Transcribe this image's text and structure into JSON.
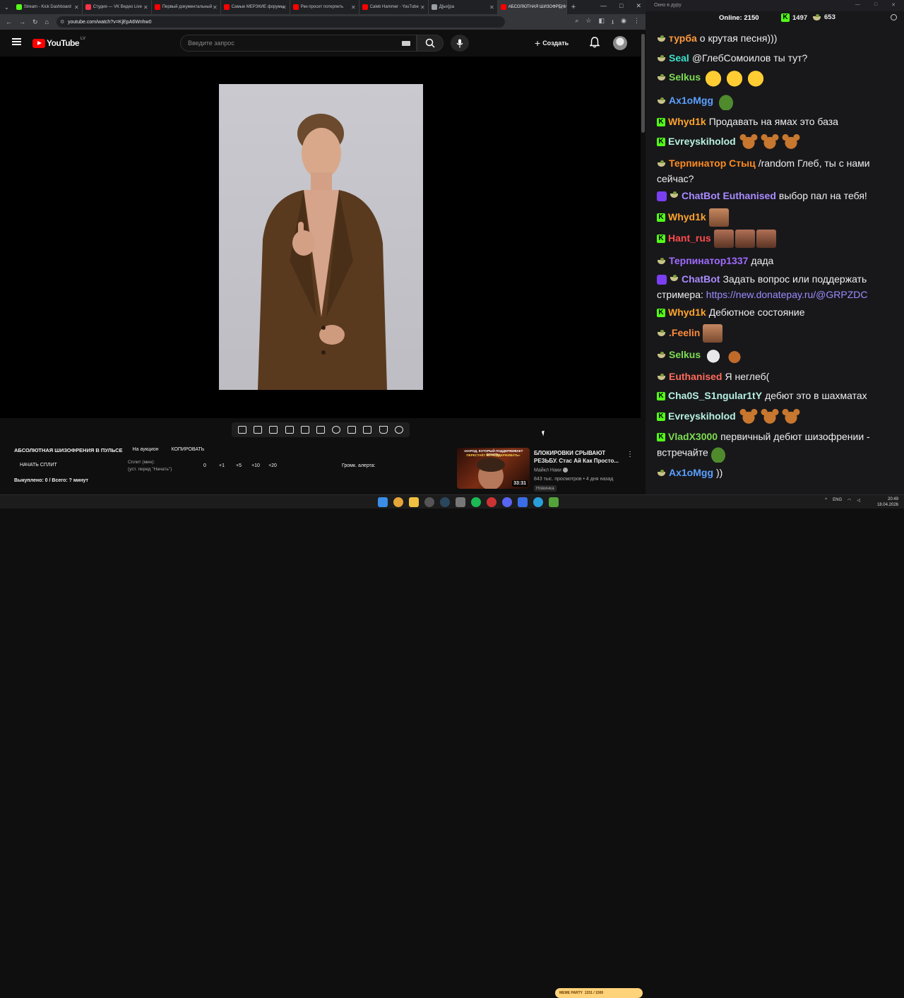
{
  "tabs": [
    {
      "label": "Stream - Kick Dashboard",
      "color": "#53fc18"
    },
    {
      "label": "Студия — VK Видео Live",
      "color": "#ff3347"
    },
    {
      "label": "Первый документальный",
      "color": "#ff0000"
    },
    {
      "label": "Самые МЕРЗКИЕ форумы",
      "color": "#ff0000"
    },
    {
      "label": "Ркн просит потерпеть",
      "color": "#ff0000"
    },
    {
      "label": "Caleb Hammer - YouTube",
      "color": "#ff0000"
    },
    {
      "label": "Д[ых]ра",
      "color": "#9aa0a6"
    },
    {
      "label": "АБСОЛЮТНАЯ ШИЗОФРЕНИЯ",
      "color": "#ff0000"
    }
  ],
  "browser": {
    "url": "youtube.com/watch?v=KjEpA6Wnhw0"
  },
  "youtube": {
    "logo": "YouTube",
    "country": "LV",
    "search_placeholder": "Введите запрос",
    "create_label": "Создать"
  },
  "overlay": {
    "title": "АБСОЛЮТНАЯ ШИЗОФРЕНИЯ В ПУЛЬСЕ",
    "auction": "На аукцион",
    "copy": "КОПИРОВАТЬ",
    "start_split": "НАЧАТЬ СПЛИТ",
    "split_label": "Сплит (мин):",
    "split_hint": "(уст. перед \"Начать\")",
    "split_value": "0",
    "increments": [
      "+1",
      "+5",
      "+10",
      "+20"
    ],
    "alert_label": "Громк. алерта:",
    "bought": "Выкуплено: 0 / Всего: ? минут"
  },
  "recommended": {
    "thumb_caption_1": "«НАРОД, КОТОРЫЙ ПОДДЕРЖИВАЕТ ВЛАСТЬ,",
    "thumb_caption_2": "ПЕРЕСТАЁТ ЕЁ ПОДДЕРЖИВАТЬ»",
    "duration": "33:31",
    "title": "БЛОКИРОВКИ СРЫВАЮТ РЕЗЬБУ. Стас Ай Как Просто...",
    "channel": "Майкл Наки",
    "views": "843 тыс. просмотров • 4 дня назад",
    "badge": "Новинка"
  },
  "chat_window": {
    "title": "Окно в дуру"
  },
  "chat_stats": {
    "online_label": "Online:",
    "online_value": "2150",
    "kick_count": "1497",
    "pot_count": "653"
  },
  "chat": [
    {
      "badges": [
        "pot"
      ],
      "user": "турба",
      "color": "#ff9a3c",
      "text": "о крутая песня)))",
      "emotes": []
    },
    {
      "badges": [
        "pot"
      ],
      "user": "Seal",
      "color": "#3ce0c8",
      "text": "@ГлебСомоилов ты тут?",
      "emotes": []
    },
    {
      "badges": [
        "pot"
      ],
      "user": "Selkus",
      "color": "#7ddc50",
      "text": "",
      "emotes": [
        "laugh",
        "laugh",
        "laugh"
      ]
    },
    {
      "badges": [
        "pot"
      ],
      "user": "Ax1oMgg",
      "color": "#5aa0ff",
      "text": "",
      "emotes": [
        "pepe"
      ]
    },
    {
      "badges": [
        "kick"
      ],
      "user": "Whyd1k",
      "color": "#ffa42a",
      "text": "Продавать на ямах это база",
      "emotes": []
    },
    {
      "badges": [
        "kick"
      ],
      "user": "Evreyskiholod",
      "color": "#b6f0e0",
      "text": "",
      "emotes": [
        "bear",
        "bear",
        "bear"
      ]
    },
    {
      "badges": [
        "pot"
      ],
      "user": "Терпинатор Стыц",
      "color": "#ff8b1f",
      "text": "/random Глеб, ты с нами сейчас?",
      "emotes": []
    },
    {
      "badges": [
        "bot",
        "pot"
      ],
      "user": "ChatBot",
      "color": "#a98bff",
      "text": "выбор пал на тебя!",
      "mention": "Euthanised",
      "emotes": []
    },
    {
      "badges": [
        "kick"
      ],
      "user": "Whyd1k",
      "color": "#ffa42a",
      "text": "",
      "emotes": [
        "face"
      ]
    },
    {
      "badges": [
        "kick"
      ],
      "user": "Hant_rus",
      "color": "#ff4b4b",
      "text": "",
      "emotes": [
        "face2",
        "face2",
        "face2"
      ]
    },
    {
      "badges": [
        "pot"
      ],
      "user": "Терпинатор1337",
      "color": "#a06bff",
      "text": "дада",
      "emotes": []
    },
    {
      "badges": [
        "bot",
        "pot"
      ],
      "user": "ChatBot",
      "color": "#a98bff",
      "text": "Задать вопрос или поддержать стримера: ",
      "link": "https://new.donatepay.ru/@GRPZDC",
      "emotes": []
    },
    {
      "badges": [
        "kick"
      ],
      "user": "Whyd1k",
      "color": "#ffa42a",
      "text": "Дебютное состояние",
      "emotes": []
    },
    {
      "badges": [
        "pot"
      ],
      "user": ".Feelin",
      "color": "#ff8b3d",
      "text": "",
      "emotes": [
        "face"
      ]
    },
    {
      "badges": [
        "pot"
      ],
      "user": "Selkus",
      "color": "#7ddc50",
      "text": "",
      "emotes": [
        "cat",
        "pot"
      ]
    },
    {
      "badges": [
        "pot"
      ],
      "user": "Euthanised",
      "color": "#ff6b5a",
      "text": "Я неглеб(",
      "emotes": []
    },
    {
      "badges": [
        "kick"
      ],
      "user": "Cha0S_S1ngular1tY",
      "color": "#b6f0e0",
      "text": "дебют это в шахматах",
      "emotes": []
    },
    {
      "badges": [
        "kick"
      ],
      "user": "Evreyskiholod",
      "color": "#b6f0e0",
      "text": "",
      "emotes": [
        "bear",
        "bear",
        "bear"
      ]
    },
    {
      "badges": [
        "kick"
      ],
      "user": "VladX3000",
      "color": "#7ddc50",
      "text": "первичный дебют шизофрении - встречайте",
      "emotes": [
        "pepe"
      ]
    },
    {
      "badges": [
        "pot"
      ],
      "user": "Ax1oMgg",
      "color": "#5aa0ff",
      "text": "))",
      "emotes": []
    }
  ],
  "taskbar": {
    "meme_label": "MEME PARTY",
    "meme_progress": "1331 / 1500",
    "lang": "ENG",
    "time": "20:49",
    "date": "18.04.2026"
  }
}
